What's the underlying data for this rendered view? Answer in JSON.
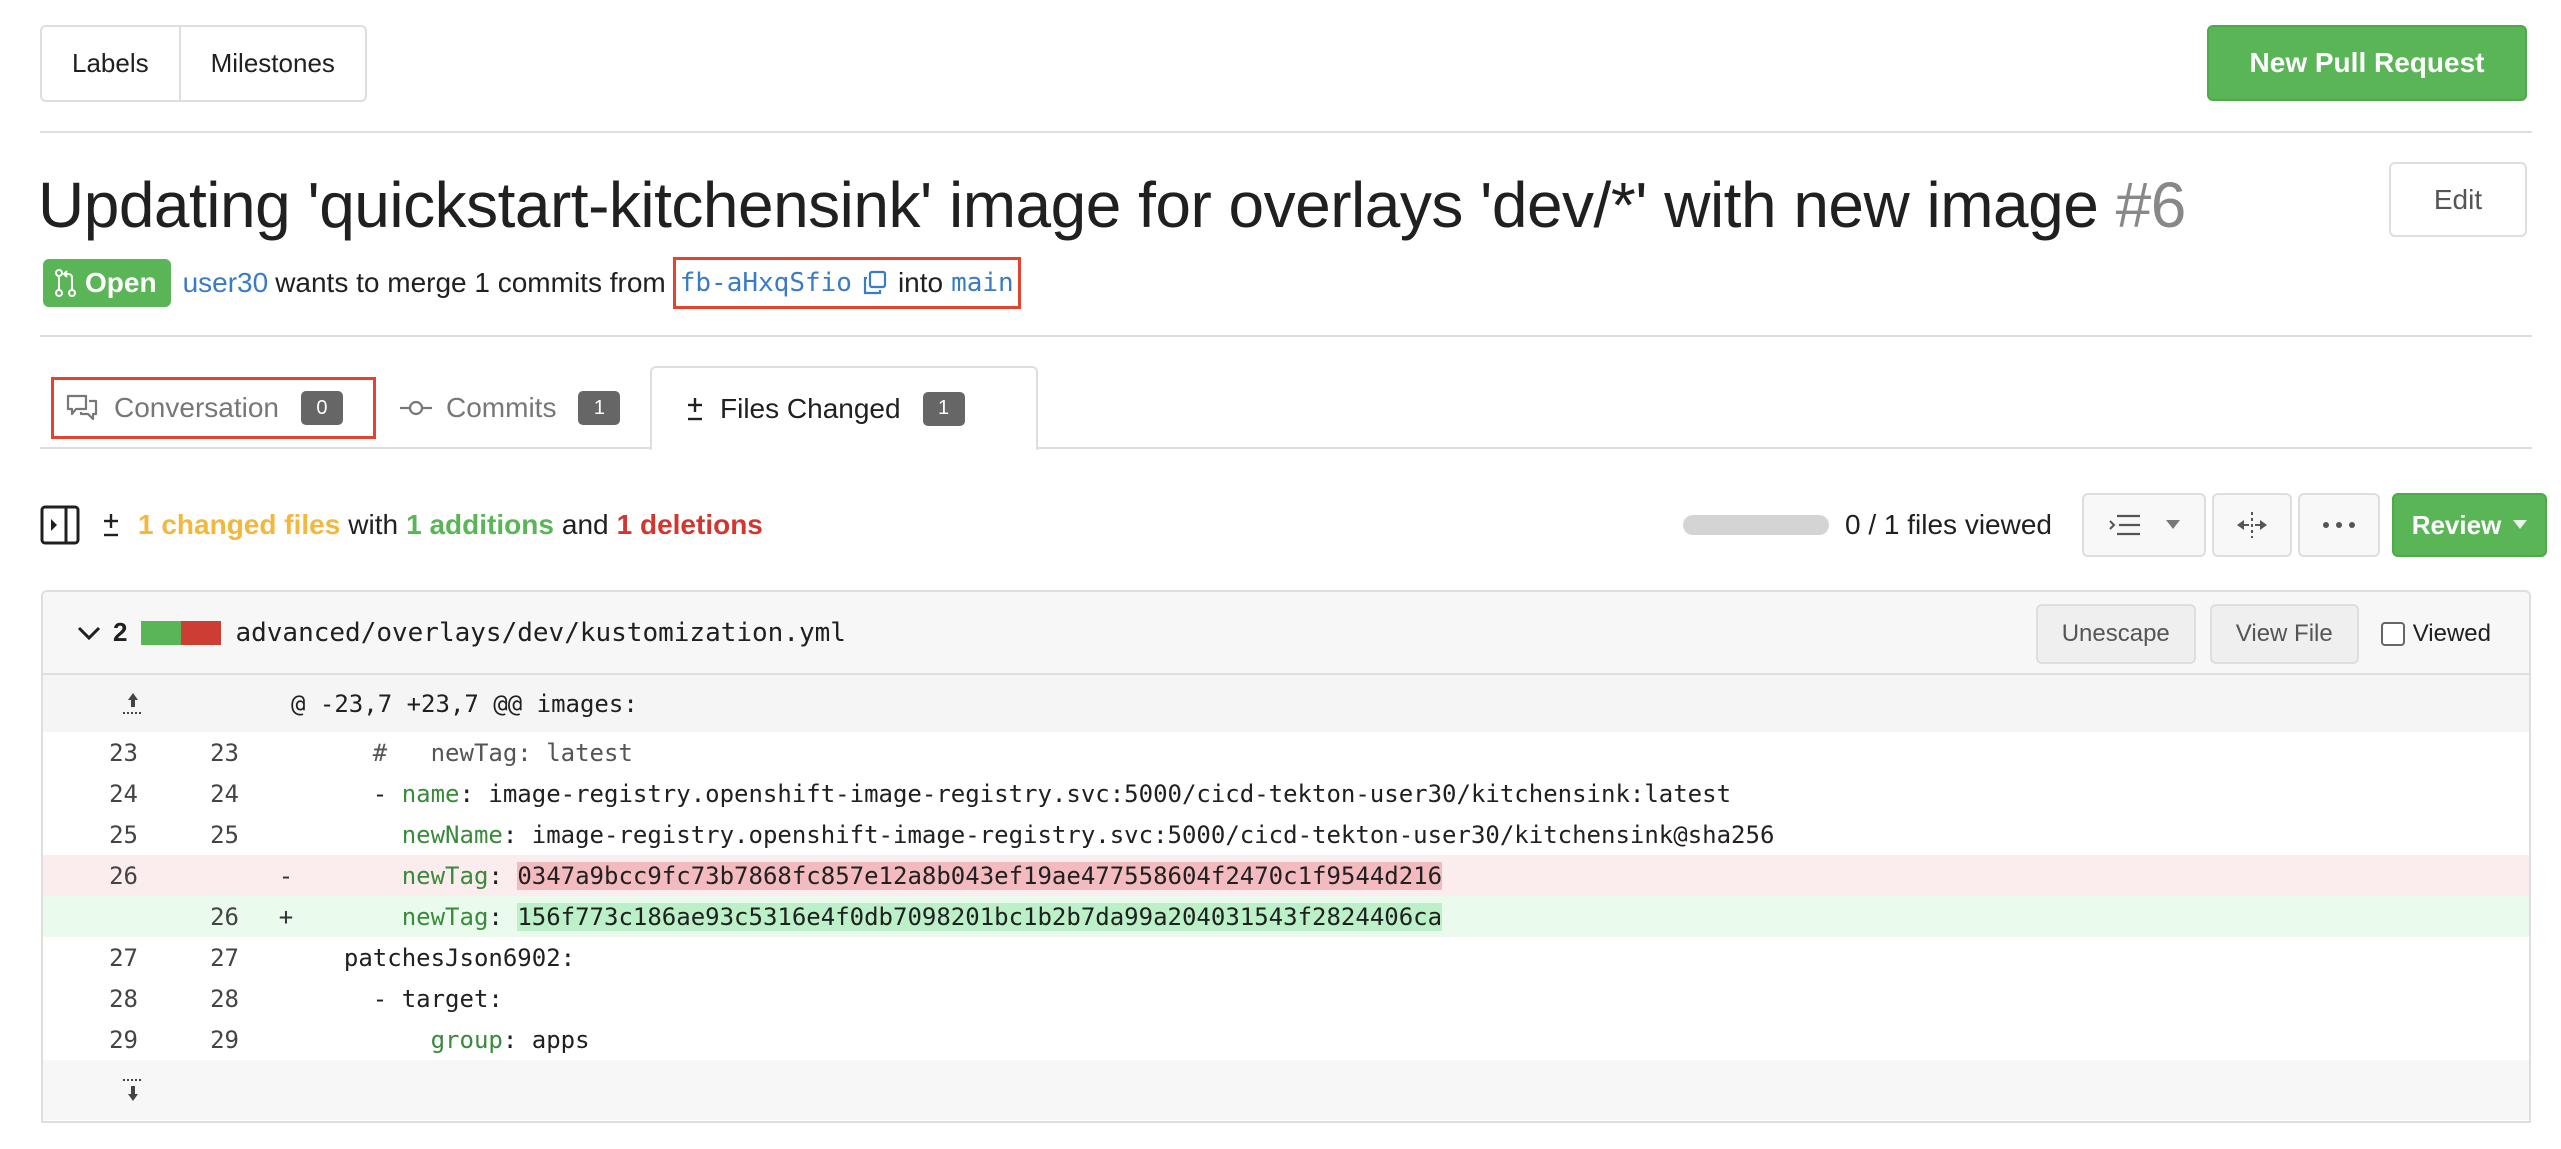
{
  "topbar": {
    "labels_btn": "Labels",
    "milestones_btn": "Milestones",
    "new_pr_btn": "New Pull Request"
  },
  "pr": {
    "title": "Updating 'quickstart-kitchensink' image for overlays 'dev/*' with new image",
    "number": "#6",
    "edit_btn": "Edit",
    "status": "Open",
    "author": "user30",
    "merge_text": "wants to merge 1 commits from",
    "head_branch": "fb-aHxqSfio",
    "into_text": "into",
    "base_branch": "main"
  },
  "tabs": [
    {
      "label": "Conversation",
      "count": "0",
      "icon": "comment-discussion-icon"
    },
    {
      "label": "Commits",
      "count": "1",
      "icon": "git-commit-icon"
    },
    {
      "label": "Files Changed",
      "count": "1",
      "icon": "diff-icon",
      "active": true
    }
  ],
  "stats": {
    "changed_files": "1 changed files",
    "with": "with",
    "additions": "1 additions",
    "and": "and",
    "deletions": "1 deletions",
    "files_viewed": "0 / 1 files viewed",
    "files_viewed_fraction": 0,
    "review_btn": "Review"
  },
  "colors": {
    "accent_green": "#5ab556",
    "deletion_red": "#d1372f",
    "changed_yellow": "#f2b73c",
    "link_blue": "#3a7bc6",
    "highlight_box": "#e5432d"
  },
  "file": {
    "change_count": "2",
    "path": "advanced/overlays/dev/kustomization.yml",
    "unescape_btn": "Unescape",
    "view_file_btn": "View File",
    "viewed_label": "Viewed",
    "hunk_header": "@ -23,7 +23,7 @@ images:",
    "lines": [
      {
        "old": "23",
        "new": "23",
        "sign": "",
        "type": "ctx",
        "indent": "    ",
        "comment": "#   newTag: latest"
      },
      {
        "old": "24",
        "new": "24",
        "sign": "",
        "type": "ctx",
        "indent": "    - ",
        "key": "name",
        "value": ": image-registry.openshift-image-registry.svc:5000/cicd-tekton-user30/kitchensink:latest"
      },
      {
        "old": "25",
        "new": "25",
        "sign": "",
        "type": "ctx",
        "indent": "      ",
        "key": "newName",
        "value": ": image-registry.openshift-image-registry.svc:5000/cicd-tekton-user30/kitchensink@sha256"
      },
      {
        "old": "26",
        "new": "",
        "sign": "-",
        "type": "del",
        "indent": "      ",
        "key": "newTag",
        "value": ": ",
        "hl": "0347a9bcc9fc73b7868fc857e12a8b043ef19ae477558604f2470c1f9544d216"
      },
      {
        "old": "",
        "new": "26",
        "sign": "+",
        "type": "add",
        "indent": "      ",
        "key": "newTag",
        "value": ": ",
        "hl": "156f773c186ae93c5316e4f0db7098201bc1b2b7da99a204031543f2824406ca"
      },
      {
        "old": "27",
        "new": "27",
        "sign": "",
        "type": "ctx",
        "indent": "  ",
        "plain": "patchesJson6902:"
      },
      {
        "old": "28",
        "new": "28",
        "sign": "",
        "type": "ctx",
        "indent": "    ",
        "plain": "- target:"
      },
      {
        "old": "29",
        "new": "29",
        "sign": "",
        "type": "ctx",
        "indent": "        ",
        "key": "group",
        "value": ": apps"
      }
    ]
  }
}
